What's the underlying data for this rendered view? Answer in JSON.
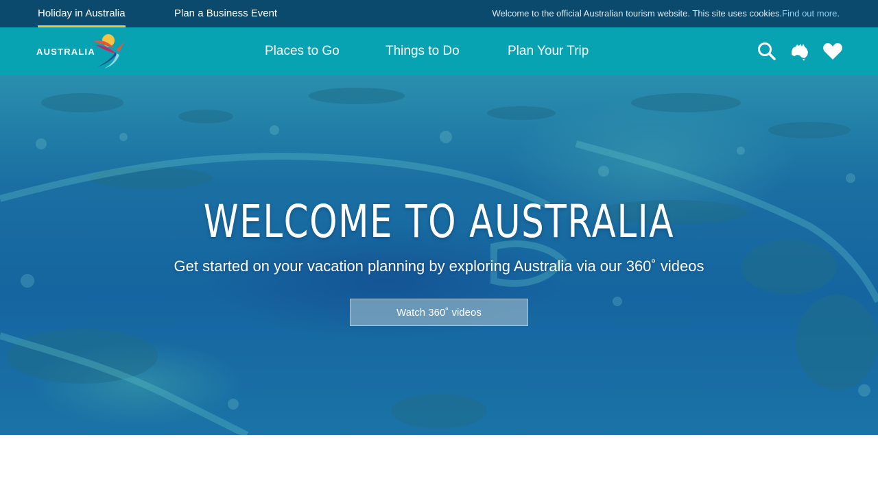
{
  "topbar": {
    "tabs": [
      {
        "label": "Holiday in Australia",
        "active": true
      },
      {
        "label": "Plan a Business Event",
        "active": false
      }
    ],
    "cookie_text": "Welcome to the official Australian tourism website. This site uses cookies.",
    "cookie_link": "Find out more",
    "cookie_end": "."
  },
  "nav": {
    "logo_text": "AUSTRALIA",
    "items": [
      "Places to Go",
      "Things to Do",
      "Plan Your Trip"
    ],
    "icons": [
      "search-icon",
      "australia-map-icon",
      "heart-icon"
    ]
  },
  "hero": {
    "title": "WELCOME TO AUSTRALIA",
    "subtitle": "Get started on your vacation planning by exploring Australia via our 360˚ videos",
    "button": "Watch 360˚ videos"
  },
  "colors": {
    "topbar_bg": "#0b4a6c",
    "navbar_bg": "#07a3b3",
    "active_underline": "#f2c23a",
    "link": "#8fd3ef"
  }
}
